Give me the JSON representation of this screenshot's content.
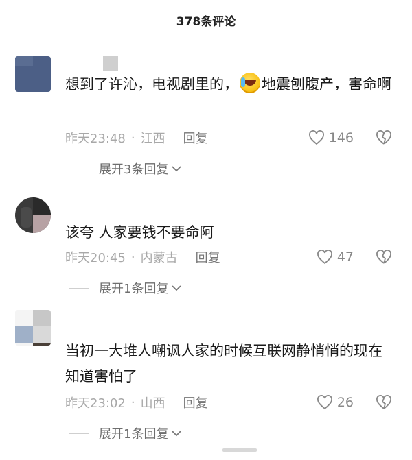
{
  "header": {
    "title": "378条评论"
  },
  "comments": [
    {
      "text_before": "想到了许沁，电视剧里的，",
      "text_after": "地震刨腹产，害命啊",
      "emoji": "crying-laughing-emoji",
      "time": "昨天23:48",
      "location": "江西",
      "reply_label": "回复",
      "likes": "146",
      "expand_label": "展开3条回复"
    },
    {
      "text": "该夸  人家要钱不要命阿",
      "time": "昨天20:45",
      "location": "内蒙古",
      "reply_label": "回复",
      "likes": "47",
      "expand_label": "展开1条回复"
    },
    {
      "text": "当初一大堆人嘲讽人家的时候互联网静悄悄的现在知道害怕了",
      "time": "昨天23:02",
      "location": "山西",
      "reply_label": "回复",
      "likes": "26",
      "expand_label": "展开1条回复"
    }
  ],
  "colors": {
    "text": "#1a1a1a",
    "meta": "#a8a8a8",
    "icon": "#888888"
  }
}
